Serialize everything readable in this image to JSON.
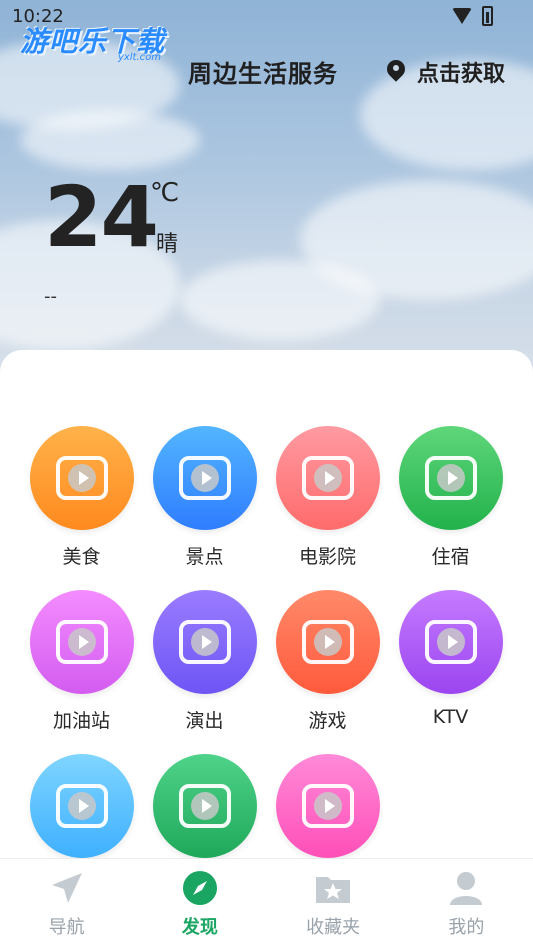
{
  "status_bar": {
    "time": "10:22"
  },
  "watermark": {
    "text": "游吧乐下载",
    "sub": "yxlt.com"
  },
  "header": {
    "title": "周边生活服务",
    "location_label": "点击获取"
  },
  "weather": {
    "temperature": "24",
    "unit": "℃",
    "condition": "晴",
    "aqi": "--"
  },
  "services": [
    {
      "label": "美食",
      "icon": "cake-icon",
      "color_from": "#ffb24a",
      "color_to": "#ff8a1f"
    },
    {
      "label": "景点",
      "icon": "tower-icon",
      "color_from": "#53b5ff",
      "color_to": "#2f7dff"
    },
    {
      "label": "电影院",
      "icon": "film-reel-icon",
      "color_from": "#ff9aa2",
      "color_to": "#ff6b6b"
    },
    {
      "label": "住宿",
      "icon": "house-icon",
      "color_from": "#5fd67a",
      "color_to": "#22b24c"
    },
    {
      "label": "加油站",
      "icon": "fuel-pump-icon",
      "color_from": "#f48cff",
      "color_to": "#d35cf0"
    },
    {
      "label": "演出",
      "icon": "ticket-icon",
      "color_from": "#9a7cff",
      "color_to": "#6e55f5"
    },
    {
      "label": "游戏",
      "icon": "gamepad-icon",
      "color_from": "#ff8a6a",
      "color_to": "#ff5a3c"
    },
    {
      "label": "KTV",
      "icon": "microphone-icon",
      "color_from": "#c57bff",
      "color_to": "#9b45f0"
    },
    {
      "label": "",
      "icon": "shopping-bag-icon",
      "color_from": "#7fd5ff",
      "color_to": "#3fb0ff"
    },
    {
      "label": "",
      "icon": "door-icon",
      "color_from": "#4fd38a",
      "color_to": "#1fa85a"
    },
    {
      "label": "",
      "icon": "beauty-icon",
      "color_from": "#ff8ad8",
      "color_to": "#ff4fb8"
    }
  ],
  "tabs": [
    {
      "label": "导航",
      "icon": "navigation-arrow-icon",
      "active": false
    },
    {
      "label": "发现",
      "icon": "compass-icon",
      "active": true
    },
    {
      "label": "收藏夹",
      "icon": "folder-star-icon",
      "active": false
    },
    {
      "label": "我的",
      "icon": "user-icon",
      "active": false
    }
  ],
  "colors": {
    "accent": "#1aa563",
    "inactive": "#9aa3ab"
  }
}
